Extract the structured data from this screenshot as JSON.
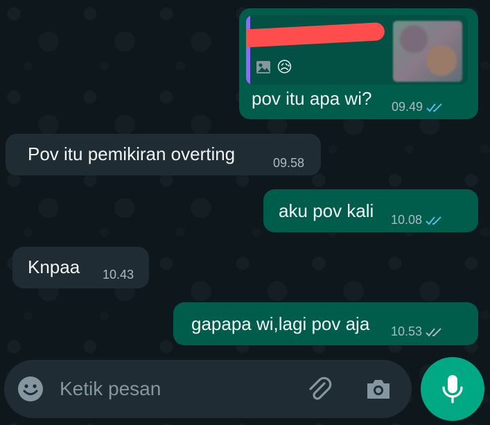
{
  "conversation": {
    "messages": [
      {
        "direction": "out",
        "text": "pov itu apa wi?",
        "time": "09.49",
        "status": "read",
        "reply_to": {
          "type": "photo",
          "emoji": "😥"
        }
      },
      {
        "direction": "in",
        "text": "Pov itu pemikiran overting",
        "time": "09.58"
      },
      {
        "direction": "out",
        "text": "aku pov kali",
        "time": "10.08",
        "status": "read"
      },
      {
        "direction": "in",
        "text": "Knpaa",
        "time": "10.43"
      },
      {
        "direction": "out",
        "text": "gapapa wi,lagi pov aja",
        "time": "10.53",
        "status": "delivered"
      }
    ]
  },
  "composer": {
    "placeholder": "Ketik pesan",
    "icons": [
      "emoji-icon",
      "attach-icon",
      "camera-icon",
      "mic-icon"
    ]
  },
  "colors": {
    "outgoing_bubble": "#005c4b",
    "incoming_bubble": "#1f2c33",
    "read_ticks": "#53bdeb",
    "delivered_ticks": "#aebac1",
    "mic_button": "#00a884"
  }
}
